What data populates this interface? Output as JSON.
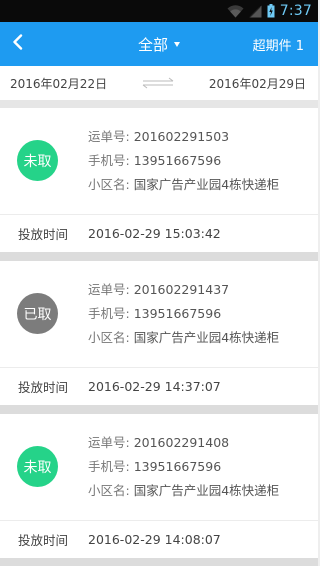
{
  "status_bar": {
    "time": "7:37",
    "icons": [
      "wifi-icon",
      "signal-icon",
      "battery-icon"
    ]
  },
  "app_bar": {
    "back_icon": "chevron-left-icon",
    "title": "全部",
    "title_dropdown_icon": "caret-down-icon",
    "right_action": "超期件 1"
  },
  "date_range": {
    "start": "2016年02月22日",
    "end": "2016年02月29日",
    "separator_icon": "swap-arrows-icon"
  },
  "labels": {
    "waybill": "运单号: ",
    "phone": "手机号: ",
    "area": "小区名: ",
    "put_time": "投放时间"
  },
  "items": [
    {
      "status": "未取",
      "status_color": "#25d389",
      "waybill": "201602291503",
      "phone": "13951667596",
      "area": "国家广告产业园4栋快递柜",
      "put_time": "2016-02-29 15:03:42"
    },
    {
      "status": "已取",
      "status_color": "#7c7c7c",
      "waybill": "201602291437",
      "phone": "13951667596",
      "area": "国家广告产业园4栋快递柜",
      "put_time": "2016-02-29 14:37:07"
    },
    {
      "status": "未取",
      "status_color": "#25d389",
      "waybill": "201602291408",
      "phone": "13951667596",
      "area": "国家广告产业园4栋快递柜",
      "put_time": "2016-02-29 14:08:07"
    }
  ],
  "colors": {
    "app_bar": "#1e9bf1",
    "status_bar": "#0a0a0a",
    "pending": "#25d389",
    "picked": "#7c7c7c"
  }
}
